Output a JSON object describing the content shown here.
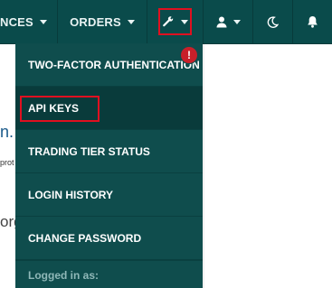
{
  "nav": {
    "finances_label": "NCES",
    "orders_label": "ORDERS",
    "tools_icon": "wrench-icon",
    "user_icon": "user-icon",
    "moon_icon": "moon-icon",
    "bell_icon": "bell-icon"
  },
  "menu": {
    "items": [
      {
        "label": "TWO-FACTOR AUTHENTICATION"
      },
      {
        "label": "API KEYS"
      },
      {
        "label": "TRADING TIER STATUS"
      },
      {
        "label": "LOGIN HISTORY"
      },
      {
        "label": "CHANGE PASSWORD"
      }
    ],
    "footer_label": "Logged in as:",
    "alert_badge": "!"
  },
  "background": {
    "text_large": "n.",
    "text_small": "prot",
    "text_org": "org"
  },
  "colors": {
    "nav_bg": "#0a4b4b",
    "menu_bg": "#0f4d4d",
    "active_item_bg": "#093b3b",
    "highlight_red": "#e01020",
    "badge_red": "#c8202a"
  }
}
